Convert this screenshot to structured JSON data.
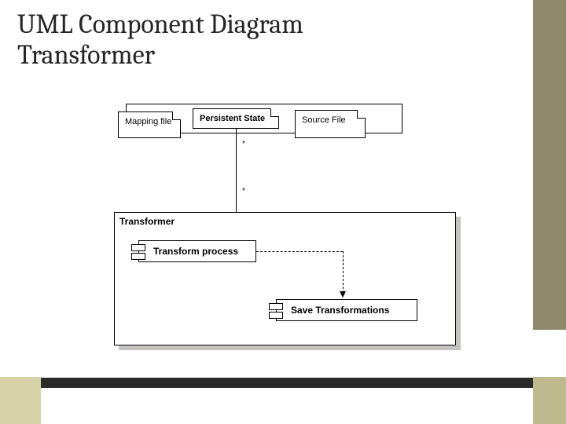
{
  "title_line1": "UML Component Diagram",
  "title_line2": "Transformer",
  "artifacts": {
    "mapping": "Mapping file",
    "persistent": "Persistent State",
    "source": "Source File"
  },
  "container_label": "Transformer",
  "components": {
    "transform": "Transform process",
    "save": "Save Transformations"
  },
  "multiplicity": {
    "top": "*",
    "bottom": "*"
  }
}
